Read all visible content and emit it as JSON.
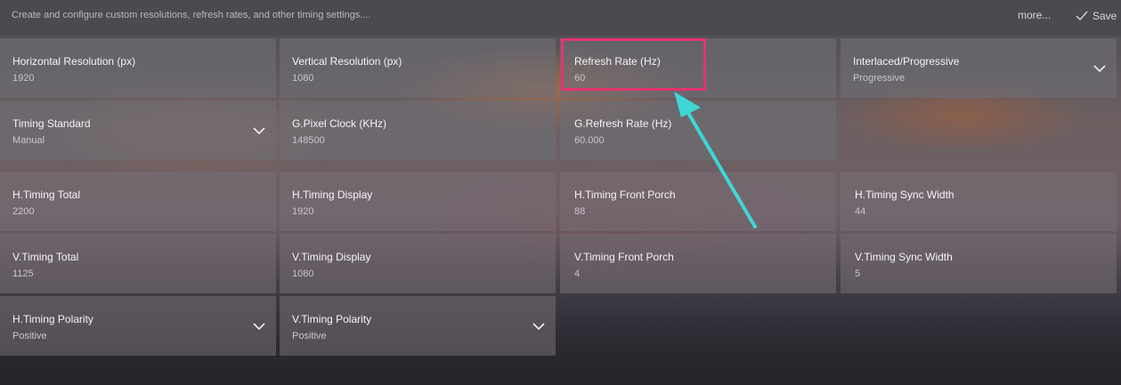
{
  "header": {
    "description": "Create and configure custom resolutions, refresh rates, and other timing settings....",
    "more_label": "more...",
    "save_label": "Save"
  },
  "fields": [
    {
      "label": "Horizontal Resolution (px)",
      "value": "1920",
      "dropdown": false
    },
    {
      "label": "Vertical Resolution (px)",
      "value": "1080",
      "dropdown": false
    },
    {
      "label": "Refresh Rate (Hz)",
      "value": "60",
      "dropdown": false,
      "highlighted": true
    },
    {
      "label": "Interlaced/Progressive",
      "value": "Progressive",
      "dropdown": true
    },
    {
      "label": "Timing Standard",
      "value": "Manual",
      "dropdown": true
    },
    {
      "label": "G.Pixel Clock (KHz)",
      "value": "148500",
      "dropdown": false
    },
    {
      "label": "G.Refresh Rate (Hz)",
      "value": "60.000",
      "dropdown": false
    },
    {
      "label": "H.Timing Total",
      "value": "2200",
      "dropdown": false
    },
    {
      "label": "H.Timing Display",
      "value": "1920",
      "dropdown": false
    },
    {
      "label": "H.Timing Front Porch",
      "value": "88",
      "dropdown": false
    },
    {
      "label": "H.Timing Sync Width",
      "value": "44",
      "dropdown": false
    },
    {
      "label": "V.Timing Total",
      "value": "1125",
      "dropdown": false
    },
    {
      "label": "V.Timing Display",
      "value": "1080",
      "dropdown": false
    },
    {
      "label": "V.Timing Front Porch",
      "value": "4",
      "dropdown": false
    },
    {
      "label": "V.Timing Sync Width",
      "value": "5",
      "dropdown": false
    },
    {
      "label": "H.Timing Polarity",
      "value": "Positive",
      "dropdown": true
    },
    {
      "label": "V.Timing Polarity",
      "value": "Positive",
      "dropdown": true
    }
  ],
  "annotation": {
    "highlight_color": "#e4346f",
    "arrow_color": "#3fd6d6"
  }
}
